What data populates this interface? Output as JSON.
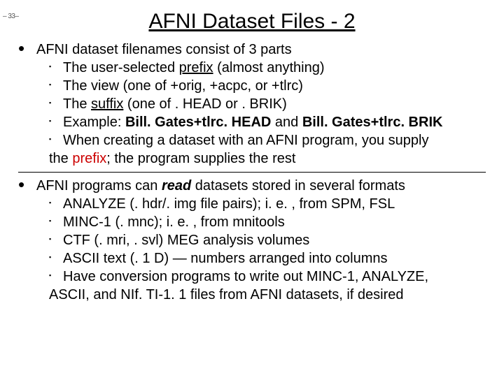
{
  "pagenum": "– 33–",
  "title": "AFNI Dataset Files - 2",
  "b1": {
    "lead": "AFNI dataset filenames consist of 3 parts",
    "s1a": "The user-selected ",
    "s1b": "prefix",
    "s1c": " (almost anything)",
    "s2": "The view (one of +orig, +acpc, or +tlrc)",
    "s3a": "The ",
    "s3b": "suffix",
    "s3c": " (one of . HEAD or . BRIK)",
    "s4a": "Example: ",
    "s4b": "Bill. Gates+tlrc. HEAD",
    "s4c": " and ",
    "s4d": "Bill. Gates+tlrc. BRIK",
    "s5a": "When creating a dataset with an AFNI program, you supply",
    "s5b": "the ",
    "s5c": "prefix",
    "s5d": "; the program supplies the rest"
  },
  "b2": {
    "lead_a": "AFNI programs can ",
    "lead_b": "read",
    "lead_c": " datasets stored in several formats",
    "s1": "ANALYZE (. hdr/. img file pairs); i. e. , from SPM, FSL",
    "s2": "MINC-1 (. mnc); i. e. , from mnitools",
    "s3": "CTF (. mri, . svl) MEG analysis volumes",
    "s4": "ASCII text (. 1 D) — numbers arranged into columns",
    "s5a": "Have conversion programs to write out MINC-1, ANALYZE,",
    "s5b": "ASCII, and NIf. TI-1. 1 files from AFNI datasets, if desired"
  }
}
